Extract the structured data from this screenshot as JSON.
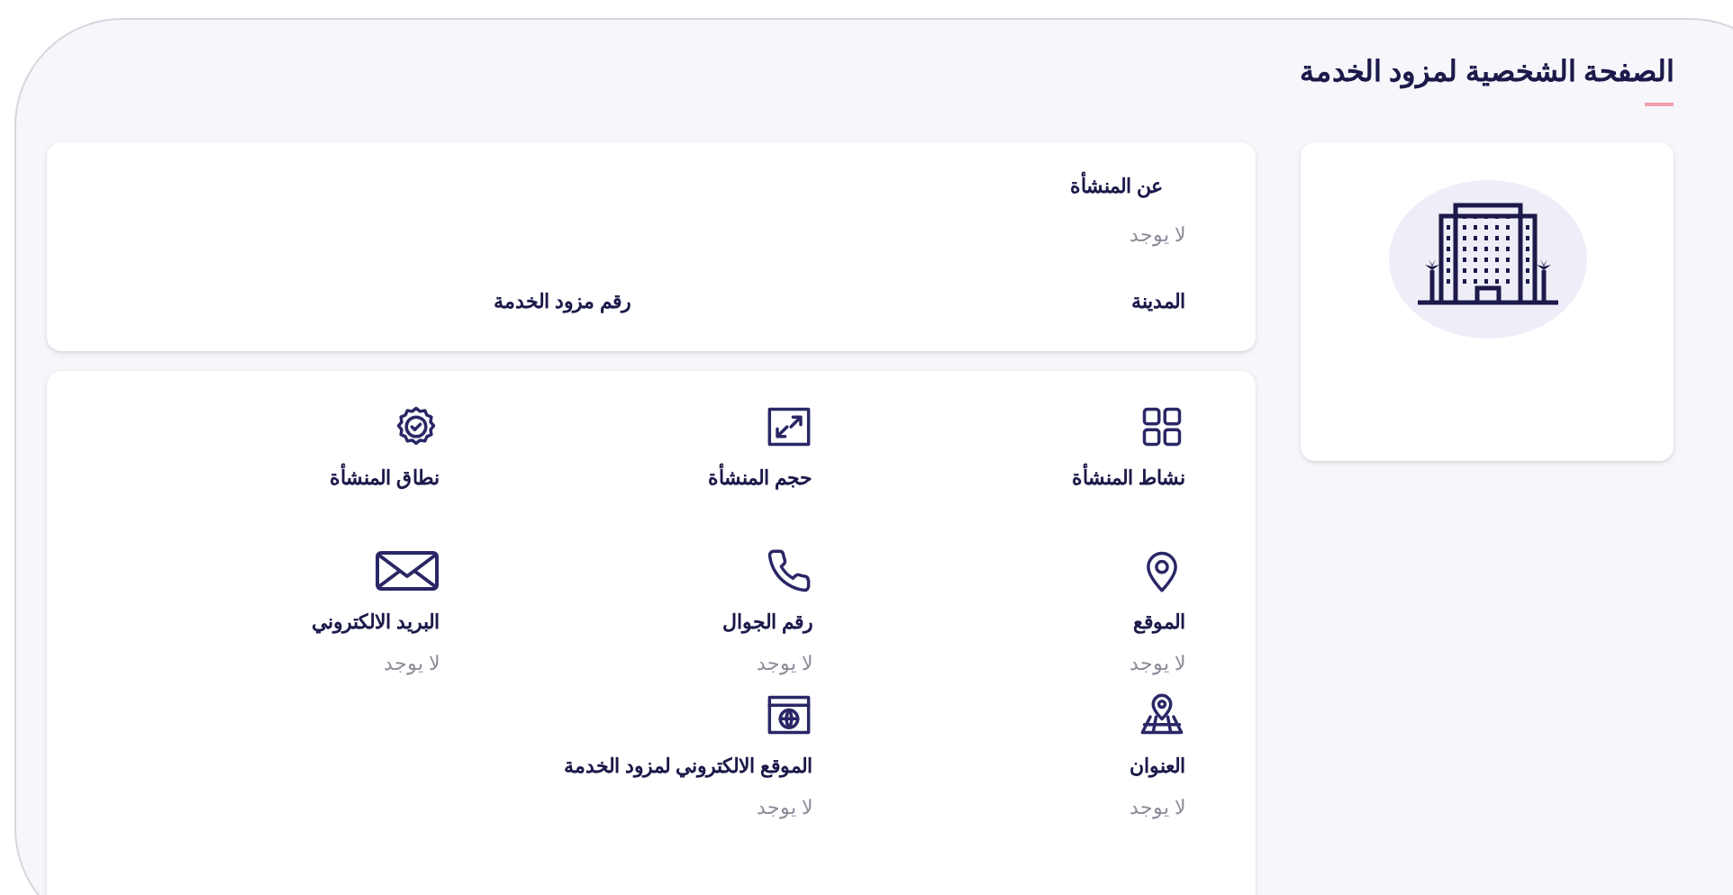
{
  "page_title": "الصفحة الشخصية لمزود الخدمة",
  "summary": {
    "about": {
      "label": "عن المنشأة",
      "value": "لا يوجد"
    },
    "fields": [
      {
        "label": "المدينة"
      },
      {
        "label": "رقم مزود الخدمة"
      }
    ]
  },
  "details": [
    {
      "kind": "grid",
      "label": "نشاط المنشأة"
    },
    {
      "kind": "resize",
      "label": "حجم المنشأة"
    },
    {
      "kind": "badge",
      "label": "نطاق المنشأة"
    },
    {
      "kind": "pin",
      "label": "الموقع",
      "value": "لا يوجد"
    },
    {
      "kind": "phone",
      "label": "رقم الجوال",
      "value": "لا يوجد"
    },
    {
      "kind": "mail",
      "label": "البريد الالكتروني",
      "value": "لا يوجد"
    },
    {
      "kind": "map",
      "label": "العنوان",
      "value": "لا يوجد"
    },
    {
      "kind": "web",
      "label": "الموقع الالكتروني لمزود الخدمة",
      "value": "لا يوجد"
    }
  ]
}
